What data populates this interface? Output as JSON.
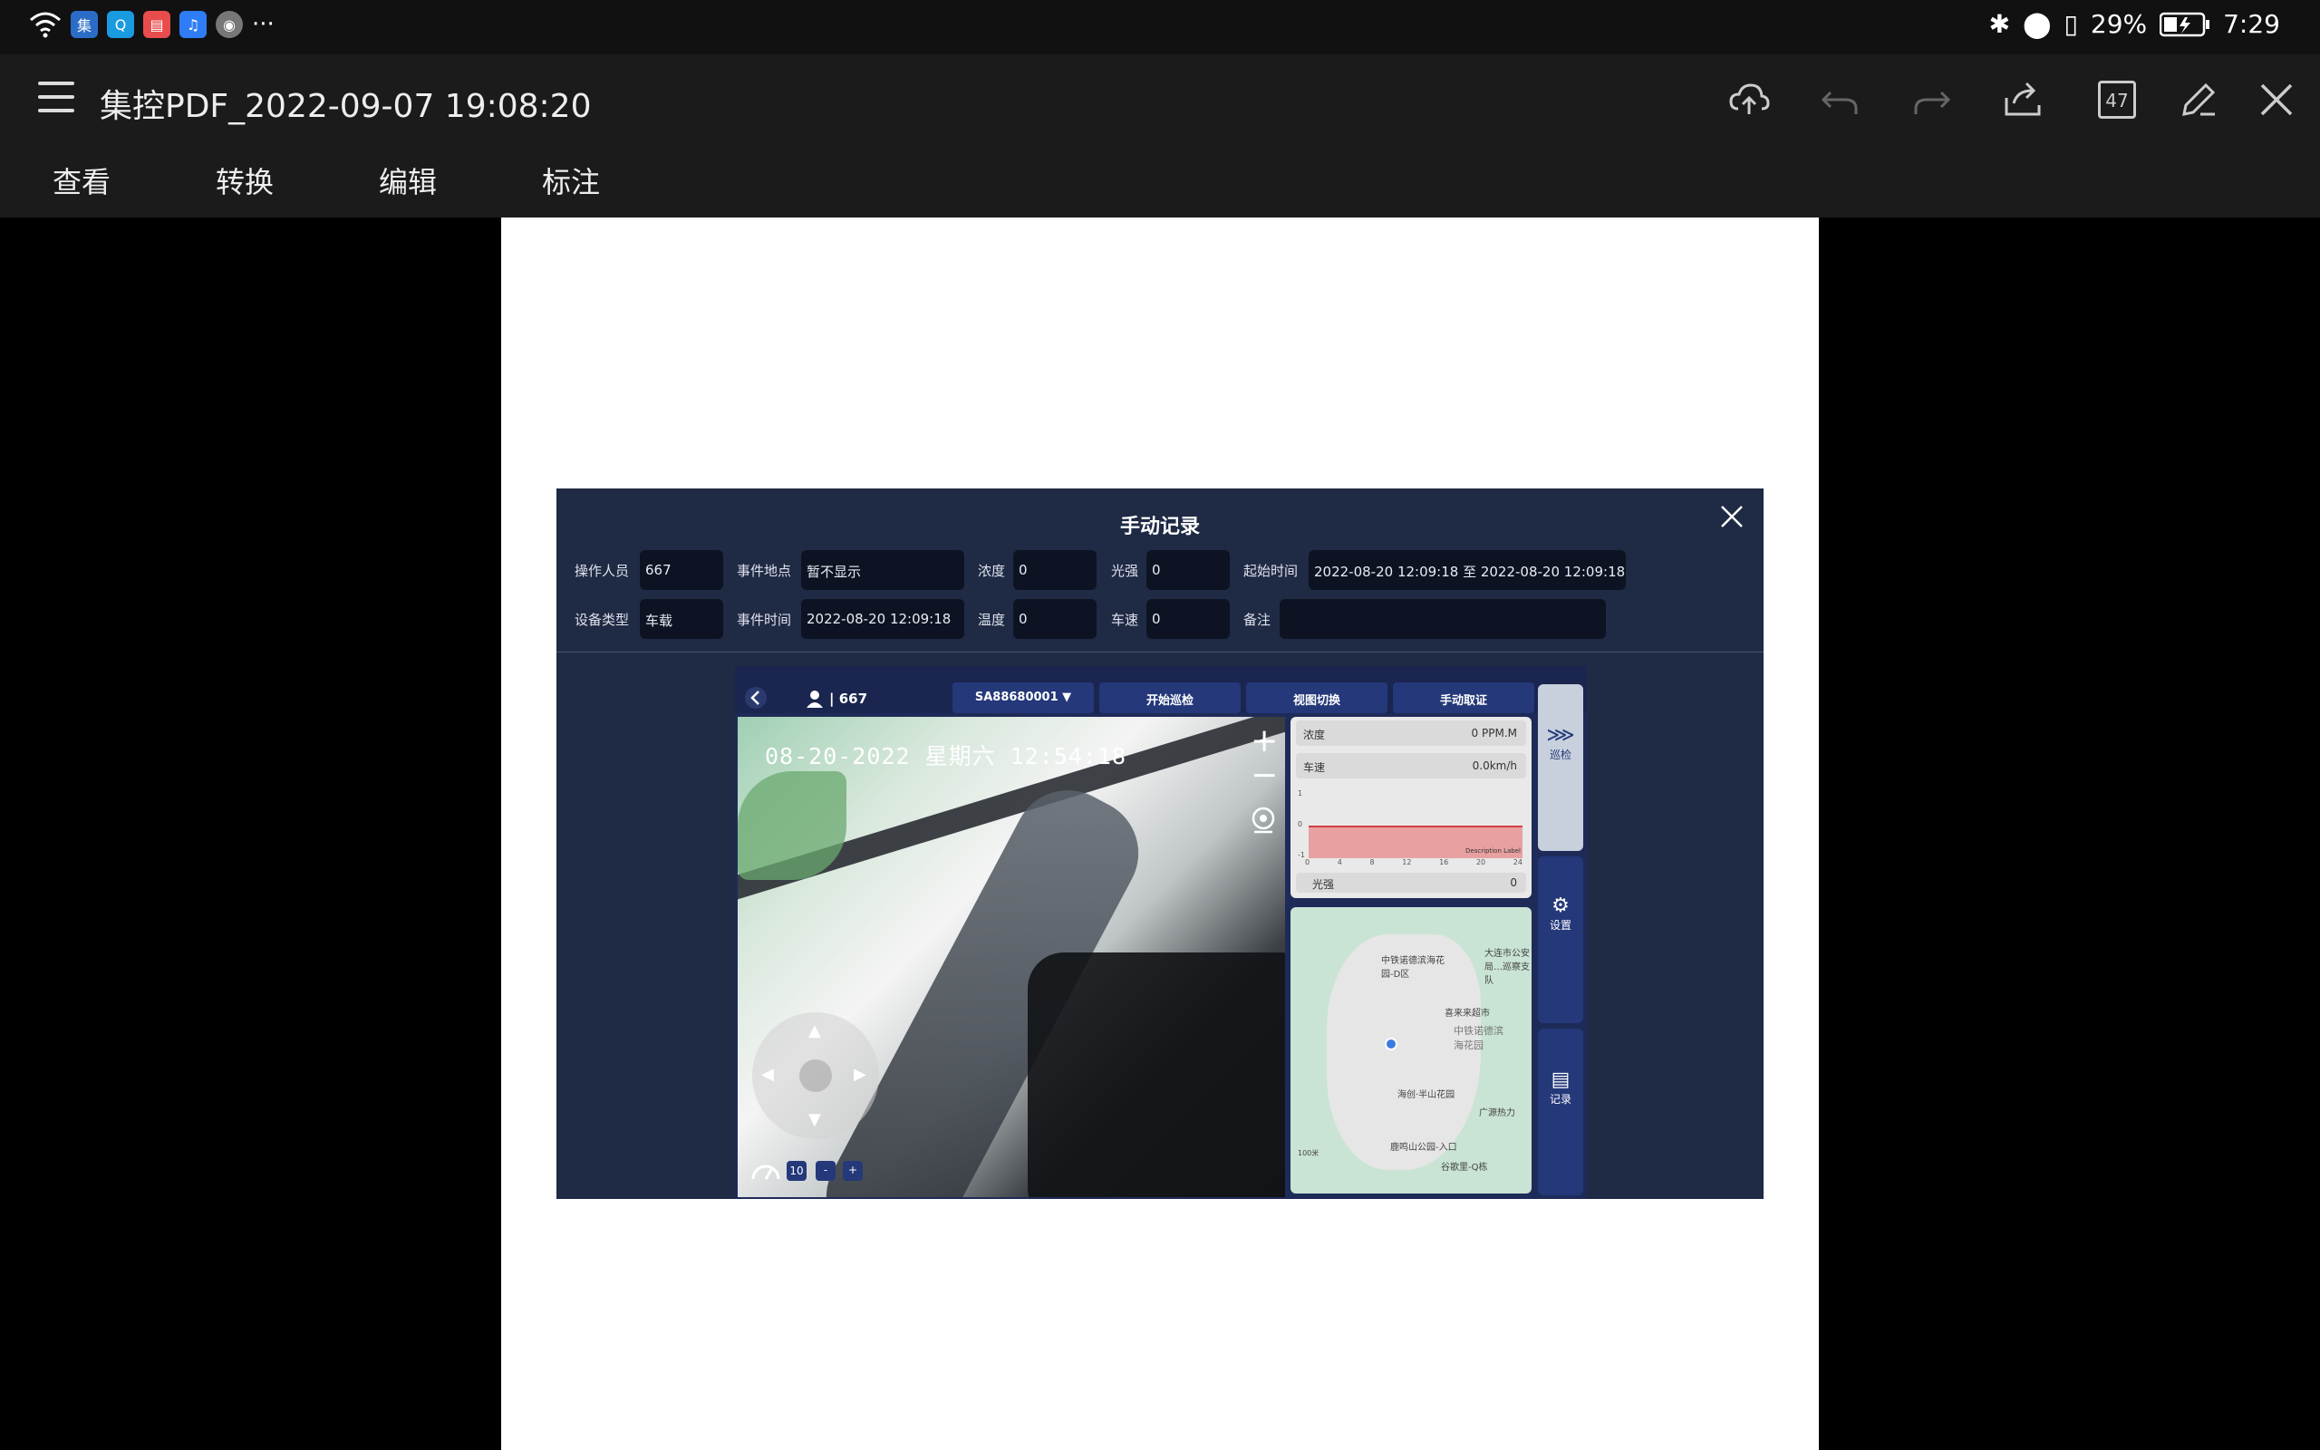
{
  "status_bar": {
    "battery": "29%",
    "time": "7:29",
    "more": "···"
  },
  "app": {
    "title": "集控PDF_2022-09-07 19:08:20",
    "page_count": "47",
    "tabs": [
      "查看",
      "转换",
      "编辑",
      "标注"
    ]
  },
  "dialog": {
    "title": "手动记录",
    "fields": {
      "operator_label": "操作人员",
      "operator_value": "667",
      "location_label": "事件地点",
      "location_value": "暂不显示",
      "concentration_label": "浓度",
      "concentration_value": "0",
      "light_label": "光强",
      "light_value": "0",
      "start_time_label": "起始时间",
      "start_time_value": "2022-08-20 12:09:18 至 2022-08-20 12:09:18",
      "device_label": "设备类型",
      "device_value": "车载",
      "event_time_label": "事件时间",
      "event_time_value": "2022-08-20 12:09:18",
      "temperature_label": "温度",
      "temperature_value": "0",
      "speed_label": "车速",
      "speed_value": "0",
      "note_label": "备注",
      "note_value": ""
    }
  },
  "screenshot": {
    "user": "| 667",
    "device_select": "SA88680001 ▼",
    "btn_patrol": "开始巡检",
    "btn_view": "视图切换",
    "btn_evidence": "手动取证",
    "camera_timestamp": "08-20-2022 星期六 12:54:18",
    "speed_level": "10",
    "minus": "-",
    "plus": "+",
    "panel": {
      "concentration_label": "浓度",
      "concentration_value": "0 PPM.M",
      "speed_label": "车速",
      "speed_value": "0.0km/h",
      "y_ticks": [
        "1",
        "0",
        "-1"
      ],
      "x_ticks": [
        "0",
        "4",
        "8",
        "12",
        "16",
        "20",
        "24"
      ],
      "desc_label": "Description Label",
      "light_label": "光强",
      "light_value": "0"
    },
    "map_labels": [
      "中铁诺德滨海花园-D区",
      "大连市公安局…巡察支队",
      "喜来来超市",
      "中铁诺德滨海花园",
      "海创·半山花园",
      "广源热力",
      "鹿鸣山公园-入口",
      "谷歌里-Q栋",
      "100米"
    ],
    "side": [
      "巡检",
      "设置",
      "记录"
    ]
  }
}
